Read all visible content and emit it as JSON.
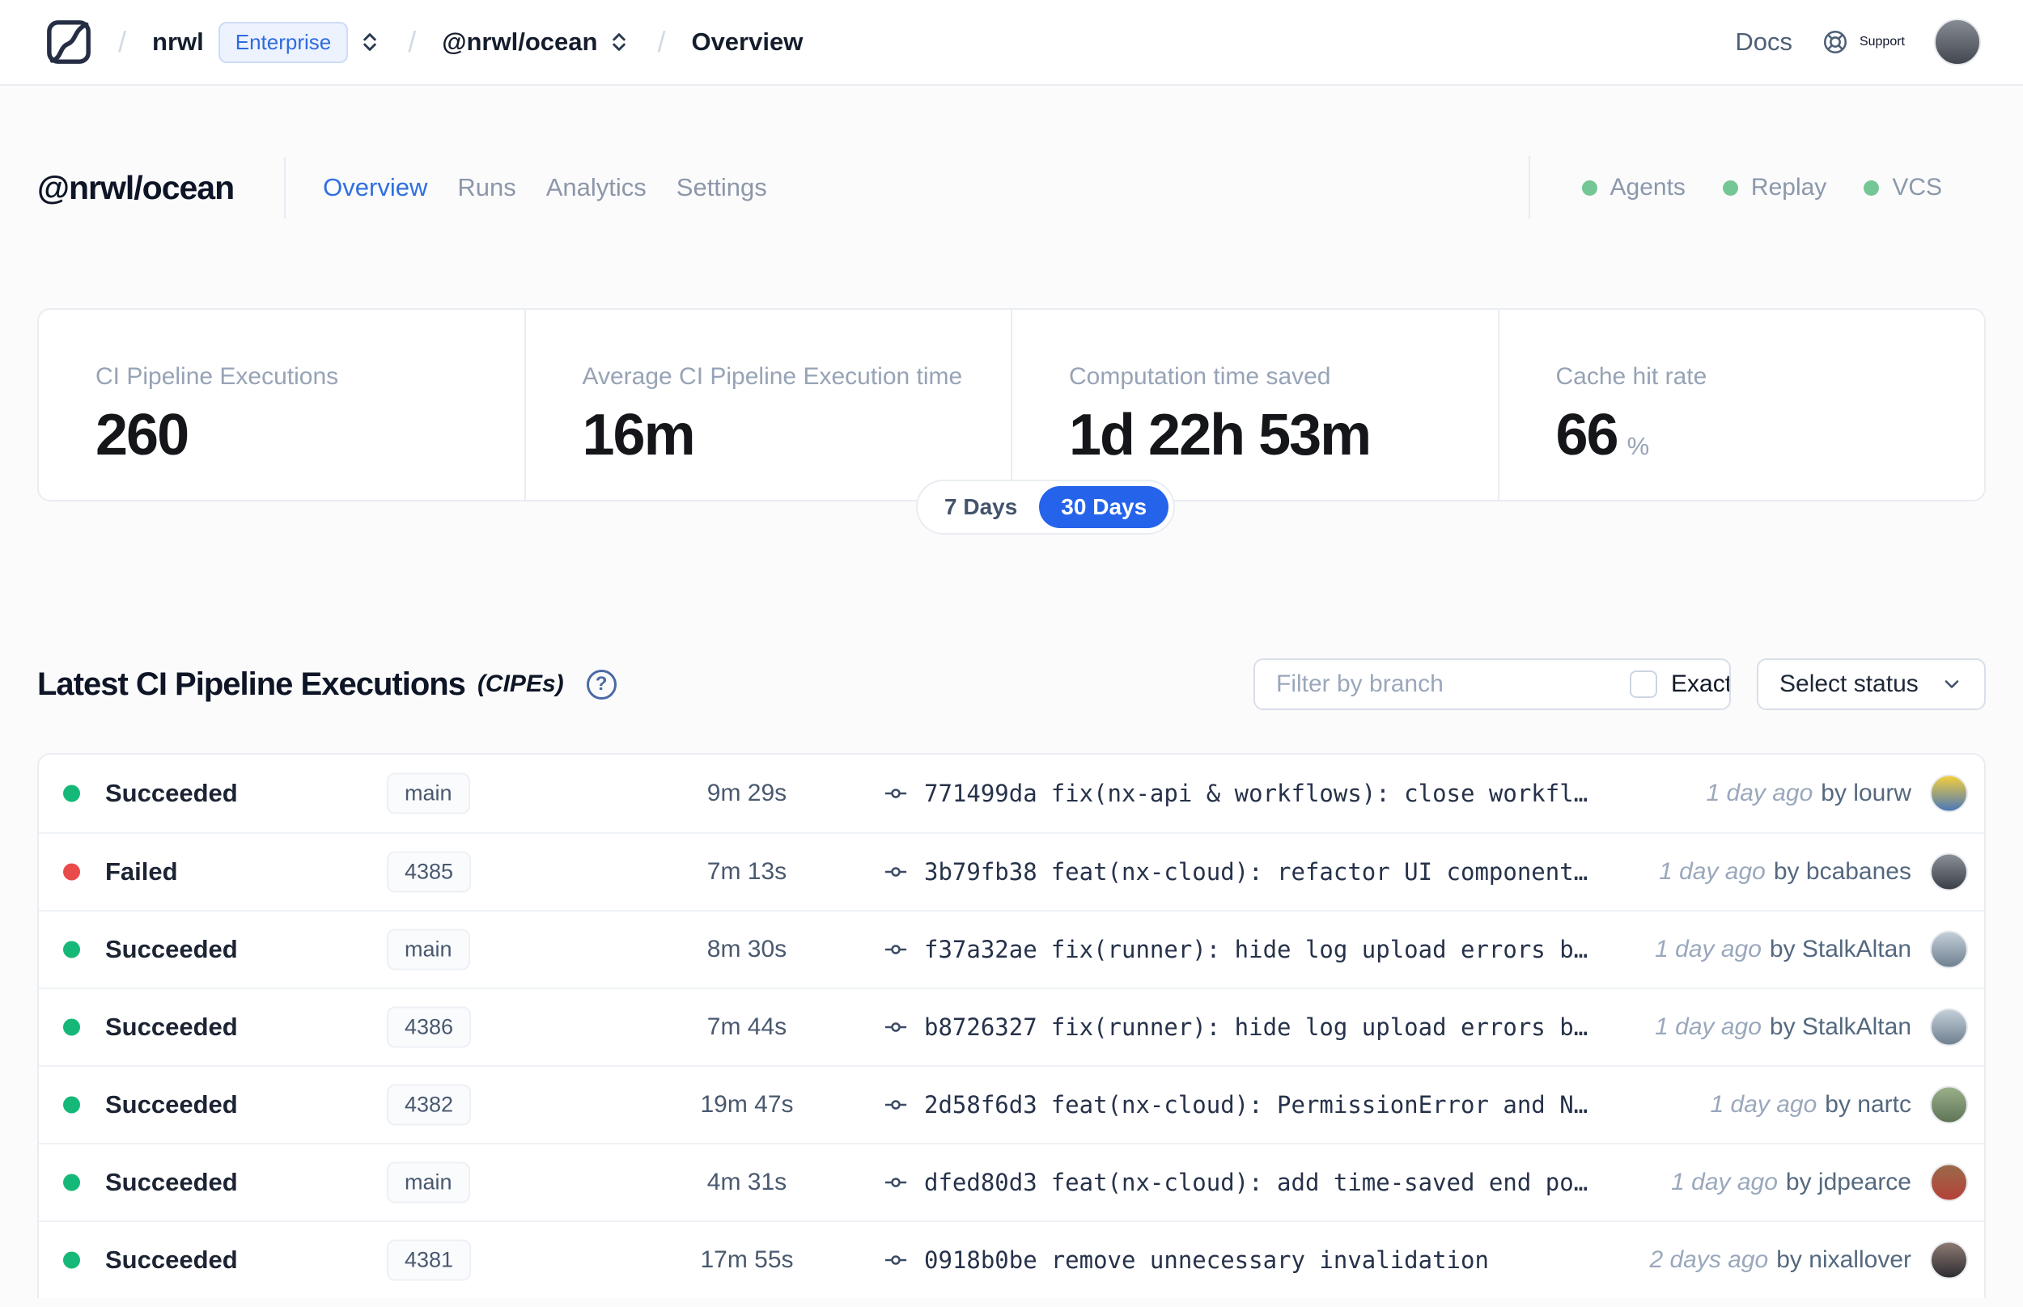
{
  "topbar": {
    "breadcrumb": {
      "separator": "/",
      "org": "nrwl",
      "org_badge": "Enterprise",
      "workspace": "@nrwl/ocean",
      "page": "Overview"
    },
    "docs_label": "Docs",
    "support_label": "Support",
    "user_avatar_colors": [
      "#868c94",
      "#43484f"
    ]
  },
  "header": {
    "title": "@nrwl/ocean",
    "tabs": [
      {
        "label": "Overview",
        "active": true
      },
      {
        "label": "Runs",
        "active": false
      },
      {
        "label": "Analytics",
        "active": false
      },
      {
        "label": "Settings",
        "active": false
      }
    ],
    "services": [
      {
        "label": "Agents"
      },
      {
        "label": "Replay"
      },
      {
        "label": "VCS"
      }
    ]
  },
  "stats": {
    "cards": [
      {
        "label": "CI Pipeline Executions",
        "value": "260",
        "suffix": ""
      },
      {
        "label": "Average CI Pipeline Execution time",
        "value": "16m",
        "suffix": ""
      },
      {
        "label": "Computation time saved",
        "value": "1d 22h 53m",
        "suffix": ""
      },
      {
        "label": "Cache hit rate",
        "value": "66",
        "suffix": "%"
      }
    ],
    "range_toggle": {
      "options": [
        "7 Days",
        "30 Days"
      ],
      "selected": "30 Days"
    }
  },
  "cipes": {
    "title": "Latest CI Pipeline Executions",
    "title_suffix": "(CIPEs)",
    "filter_placeholder": "Filter by branch",
    "exact_label": "Exact",
    "status_select_label": "Select status",
    "by_label": "by",
    "rows": [
      {
        "status": "Succeeded",
        "result": "success",
        "branch": "main",
        "duration": "9m 29s",
        "commit": "771499da",
        "message": "fix(nx-api & workflows): close workfl…",
        "time_ago": "1 day ago",
        "author": "lourw",
        "avatar_colors": [
          "#f4cf3d",
          "#4a77b8"
        ]
      },
      {
        "status": "Failed",
        "result": "failed",
        "branch": "4385",
        "duration": "7m 13s",
        "commit": "3b79fb38",
        "message": "feat(nx-cloud): refactor UI component…",
        "time_ago": "1 day ago",
        "author": "bcabanes",
        "avatar_colors": [
          "#8a9097",
          "#3a3f46"
        ]
      },
      {
        "status": "Succeeded",
        "result": "success",
        "branch": "main",
        "duration": "8m 30s",
        "commit": "f37a32ae",
        "message": "fix(runner): hide log upload errors b…",
        "time_ago": "1 day ago",
        "author": "StalkAltan",
        "avatar_colors": [
          "#c3cfd9",
          "#708090"
        ]
      },
      {
        "status": "Succeeded",
        "result": "success",
        "branch": "4386",
        "duration": "7m 44s",
        "commit": "b8726327",
        "message": "fix(runner): hide log upload errors b…",
        "time_ago": "1 day ago",
        "author": "StalkAltan",
        "avatar_colors": [
          "#c3cfd9",
          "#708090"
        ]
      },
      {
        "status": "Succeeded",
        "result": "success",
        "branch": "4382",
        "duration": "19m 47s",
        "commit": "2d58f6d3",
        "message": "feat(nx-cloud): PermissionError and N…",
        "time_ago": "1 day ago",
        "author": "nartc",
        "avatar_colors": [
          "#9ab08a",
          "#5f7456"
        ]
      },
      {
        "status": "Succeeded",
        "result": "success",
        "branch": "main",
        "duration": "4m 31s",
        "commit": "dfed80d3",
        "message": "feat(nx-cloud): add time-saved end po…",
        "time_ago": "1 day ago",
        "author": "jdpearce",
        "avatar_colors": [
          "#9a6a4a",
          "#b5423a"
        ]
      },
      {
        "status": "Succeeded",
        "result": "success",
        "branch": "4381",
        "duration": "17m 55s",
        "commit": "0918b0be",
        "message": "remove unnecessary invalidation",
        "time_ago": "2 days ago",
        "author": "nixallover",
        "avatar_colors": [
          "#8c7a72",
          "#2e2c31"
        ]
      }
    ]
  },
  "colors": {
    "accent_blue": "#2563eb",
    "success_green": "#16b877",
    "failed_red": "#e94b4b",
    "service_green": "#74c794"
  }
}
